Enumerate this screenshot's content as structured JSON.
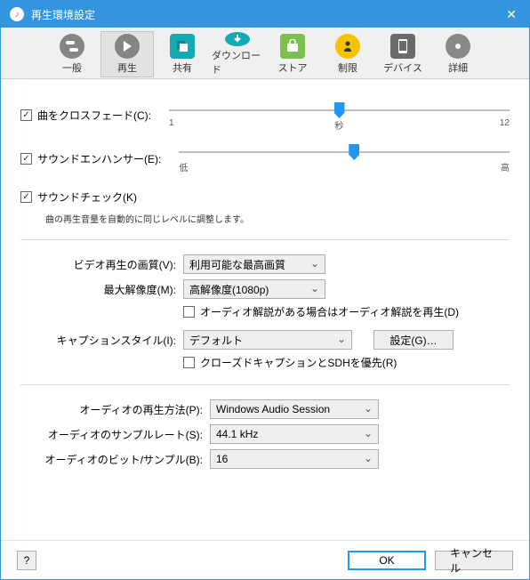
{
  "window": {
    "title": "再生環境設定"
  },
  "toolbar": {
    "items": [
      {
        "label": "一般"
      },
      {
        "label": "再生"
      },
      {
        "label": "共有"
      },
      {
        "label": "ダウンロード"
      },
      {
        "label": "ストア"
      },
      {
        "label": "制限"
      },
      {
        "label": "デバイス"
      },
      {
        "label": "詳細"
      }
    ]
  },
  "crossfade": {
    "label": "曲をクロスフェード(C):",
    "checked": true,
    "min": "1",
    "mid": "秒",
    "max": "12",
    "value": 50
  },
  "enhancer": {
    "label": "サウンドエンハンサー(E):",
    "checked": true,
    "min": "低",
    "max": "高",
    "value": 53
  },
  "soundcheck": {
    "label": "サウンドチェック(K)",
    "checked": true,
    "note": "曲の再生音量を自動的に同じレベルに調整します。"
  },
  "video": {
    "quality_label": "ビデオ再生の画質(V):",
    "quality_value": "利用可能な最高画質",
    "maxres_label": "最大解像度(M):",
    "maxres_value": "高解像度(1080p)",
    "audio_desc_label": "オーディオ解説がある場合はオーディオ解説を再生(D)",
    "caption_style_label": "キャプションスタイル(I):",
    "caption_style_value": "デフォルト",
    "caption_settings_btn": "設定(G)…",
    "closed_caption_label": "クローズドキャプションとSDHを優先(R)"
  },
  "audio": {
    "method_label": "オーディオの再生方法(P):",
    "method_value": "Windows Audio Session",
    "samplerate_label": "オーディオのサンプルレート(S):",
    "samplerate_value": "44.1 kHz",
    "bits_label": "オーディオのビット/サンプル(B):",
    "bits_value": "16"
  },
  "footer": {
    "help": "?",
    "ok": "OK",
    "cancel": "キャンセル"
  }
}
